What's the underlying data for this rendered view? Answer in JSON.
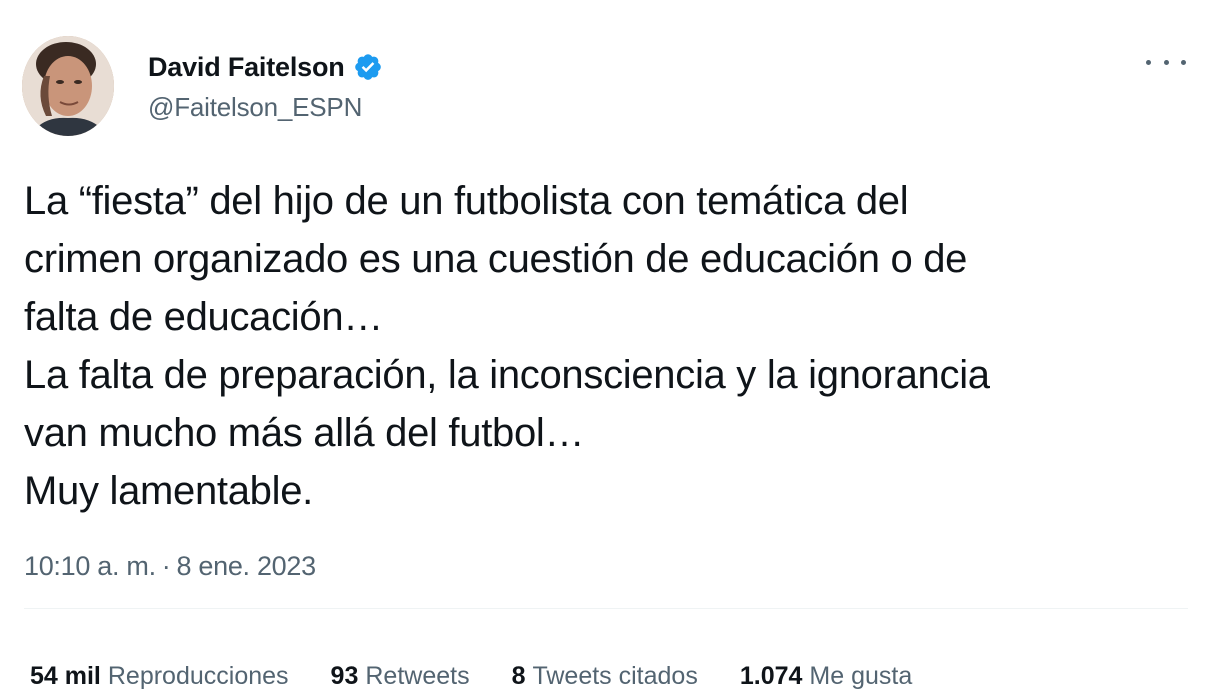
{
  "author": {
    "display_name": "David Faitelson",
    "handle": "@Faitelson_ESPN",
    "verified": true,
    "avatar_icon": "profile-photo",
    "verified_icon": "verified-badge-icon",
    "verified_color": "#1d9bf0"
  },
  "more_icon": "more-options-icon",
  "tweet": {
    "lines": [
      "La “fiesta” del hijo de un futbolista con temática del",
      "crimen organizado es una cuestión de educación o de",
      "falta de educación…",
      "La falta de preparación, la inconsciencia y la ignorancia",
      "van mucho más allá del futbol…",
      "Muy lamentable."
    ]
  },
  "timestamp": {
    "time": "10:10 a. m.",
    "separator": "·",
    "date": "8 ene. 2023"
  },
  "stats": [
    {
      "value": "54 mil",
      "label": "Reproducciones"
    },
    {
      "value": "93",
      "label": "Retweets"
    },
    {
      "value": "8",
      "label": "Tweets citados"
    },
    {
      "value": "1.074",
      "label": "Me gusta"
    }
  ],
  "colors": {
    "text_primary": "#0f1419",
    "text_secondary": "#536471",
    "divider": "#eff3f4"
  }
}
